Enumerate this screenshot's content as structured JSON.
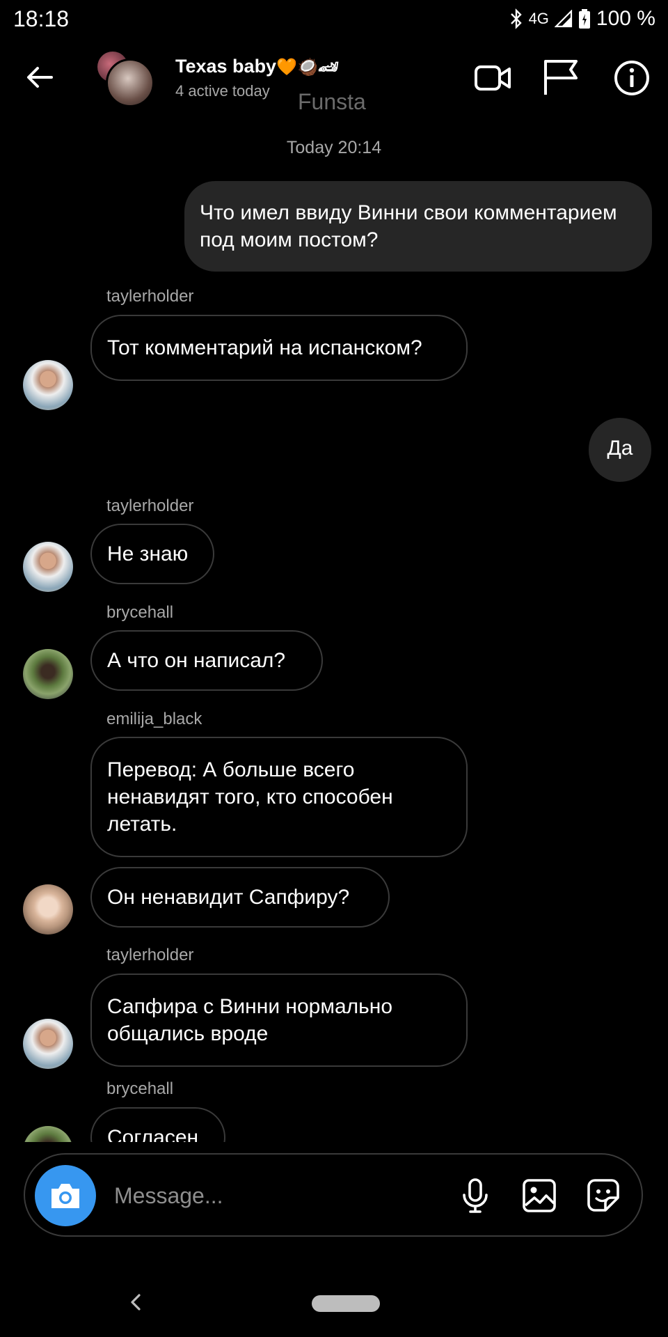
{
  "status": {
    "time": "18:18",
    "network": "4G",
    "battery": "100 %"
  },
  "header": {
    "title": "Texas baby",
    "title_emoji": "🧡🥥🏎",
    "subtitle": "4 active today",
    "overlay_text": "Funsta"
  },
  "date_separator": "Today 20:14",
  "messages": [
    {
      "type": "out",
      "text": "Что имел ввиду Винни свои комментарием под моим постом?"
    },
    {
      "type": "in",
      "sender": "taylerholder",
      "text": "Тот комментарий на испанском?"
    },
    {
      "type": "out",
      "text": "Да"
    },
    {
      "type": "in",
      "sender": "taylerholder",
      "text": "Не знаю"
    },
    {
      "type": "in",
      "sender": "brycehall",
      "text": "А что он написал?"
    },
    {
      "type": "in",
      "sender": "emilija_black",
      "text": "Перевод: А больше всего ненавидят того, кто способен летать."
    },
    {
      "type": "in",
      "text": "Он ненавидит Сапфиру?"
    },
    {
      "type": "in",
      "sender": "taylerholder",
      "text": "Сапфира с Винни нормально общались вроде"
    },
    {
      "type": "in",
      "sender": "brycehall",
      "text": "Согласен"
    }
  ],
  "composer": {
    "placeholder": "Message..."
  },
  "icons": {
    "back": "back-arrow-icon",
    "video": "video-call-icon",
    "flag": "flag-icon",
    "info": "info-icon",
    "camera": "camera-icon",
    "mic": "microphone-icon",
    "gallery": "gallery-icon",
    "sticker": "sticker-icon"
  },
  "colors": {
    "accent": "#3797f0",
    "outgoing_bubble": "#262626",
    "background": "#000000",
    "muted_text": "#a8a8a8"
  }
}
